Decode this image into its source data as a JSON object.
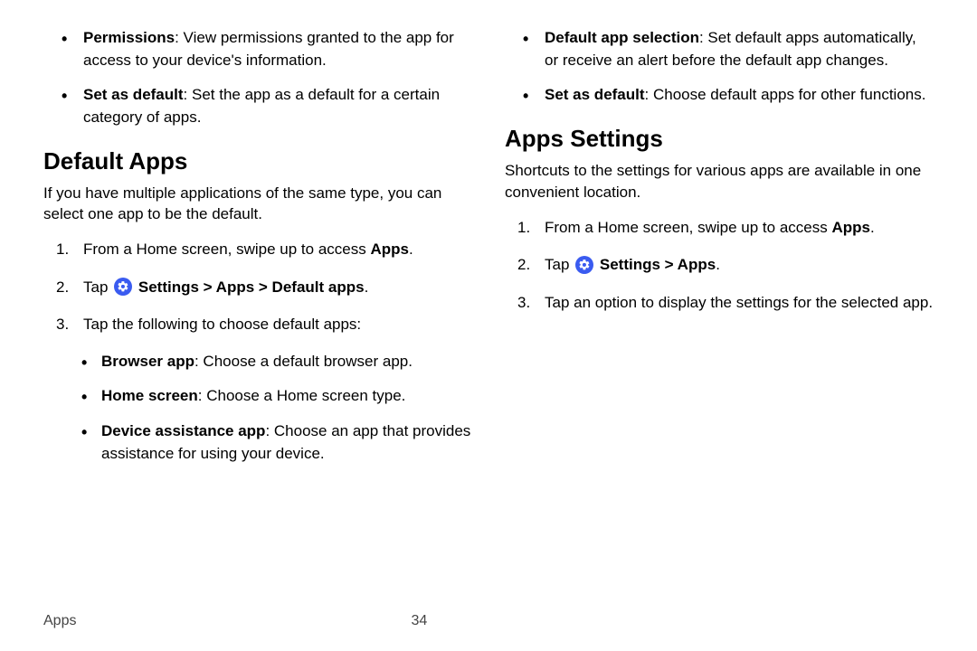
{
  "footer": {
    "section": "Apps",
    "page": "34"
  },
  "left": {
    "top_bullets": [
      {
        "term": "Permissions",
        "text": ": View permissions granted to the app for access to your device's information."
      },
      {
        "term": "Set as default",
        "text": ": Set the app as a default for a certain category of apps."
      }
    ],
    "heading": "Default Apps",
    "intro": "If you have multiple applications of the same type, you can select one app to be the default.",
    "step1_pre": "From a Home screen, swipe up to access ",
    "step1_bold": "Apps",
    "step1_post": ".",
    "step2_pre": "Tap ",
    "step2_bold": "Settings > Apps > Default apps",
    "step2_post": ".",
    "step3": "Tap the following to choose default apps:",
    "sub_bullets": [
      {
        "term": "Browser app",
        "text": ": Choose a default browser app."
      },
      {
        "term": "Home screen",
        "text": ": Choose a Home screen type."
      },
      {
        "term": "Device assistance app",
        "text": ": Choose an app that provides assistance for using your device."
      }
    ]
  },
  "right": {
    "top_bullets": [
      {
        "term": "Default app selection",
        "text": ": Set default apps automatically, or receive an alert before the default app changes."
      },
      {
        "term": "Set as default",
        "text": ": Choose default apps for other functions."
      }
    ],
    "heading": "Apps Settings",
    "intro": "Shortcuts to the settings for various apps are available in one convenient location.",
    "step1_pre": "From a Home screen, swipe up to access ",
    "step1_bold": "Apps",
    "step1_post": ".",
    "step2_pre": "Tap ",
    "step2_bold": "Settings > Apps",
    "step2_post": ".",
    "step3": "Tap an option to display the settings for the selected app."
  },
  "icon_color": "#3a5bf0"
}
